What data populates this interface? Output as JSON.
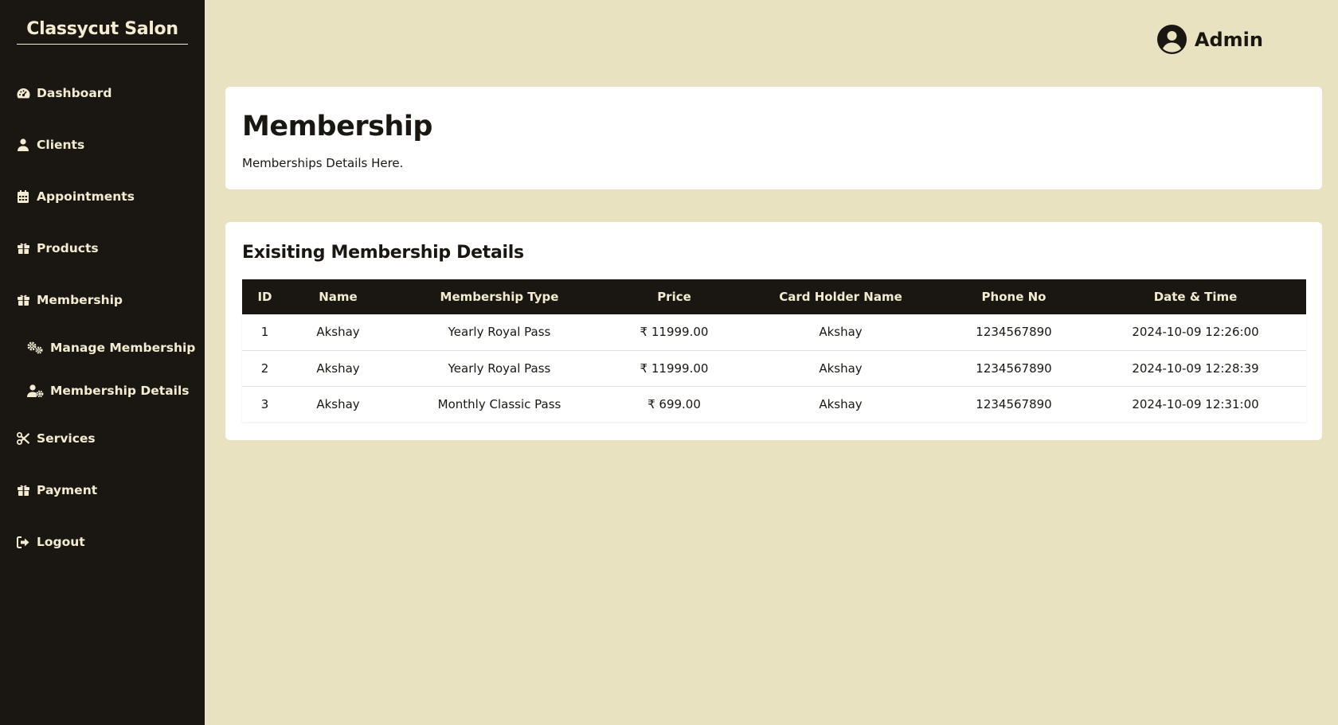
{
  "brand": "Classycut Salon",
  "user": {
    "name": "Admin"
  },
  "nav": {
    "dashboard": "Dashboard",
    "clients": "Clients",
    "appointments": "Appointments",
    "products": "Products",
    "membership": "Membership",
    "manage_membership": "Manage Membership",
    "membership_details": "Membership Details",
    "services": "Services",
    "payment": "Payment",
    "logout": "Logout"
  },
  "page": {
    "title": "Membership",
    "subtitle": "Memberships Details Here."
  },
  "table": {
    "title": "Exisiting Membership Details",
    "columns": [
      "ID",
      "Name",
      "Membership Type",
      "Price",
      "Card Holder Name",
      "Phone No",
      "Date & Time"
    ],
    "rows": [
      [
        "1",
        "Akshay",
        "Yearly Royal Pass",
        "₹ 11999.00",
        "Akshay",
        "1234567890",
        "2024-10-09 12:26:00"
      ],
      [
        "2",
        "Akshay",
        "Yearly Royal Pass",
        "₹ 11999.00",
        "Akshay",
        "1234567890",
        "2024-10-09 12:28:39"
      ],
      [
        "3",
        "Akshay",
        "Monthly Classic Pass",
        "₹ 699.00",
        "Akshay",
        "1234567890",
        "2024-10-09 12:31:00"
      ]
    ]
  },
  "colors": {
    "sidebar_bg": "#1a1712",
    "page_bg": "#e8e2c1",
    "accent_text": "#f3ecd2"
  }
}
